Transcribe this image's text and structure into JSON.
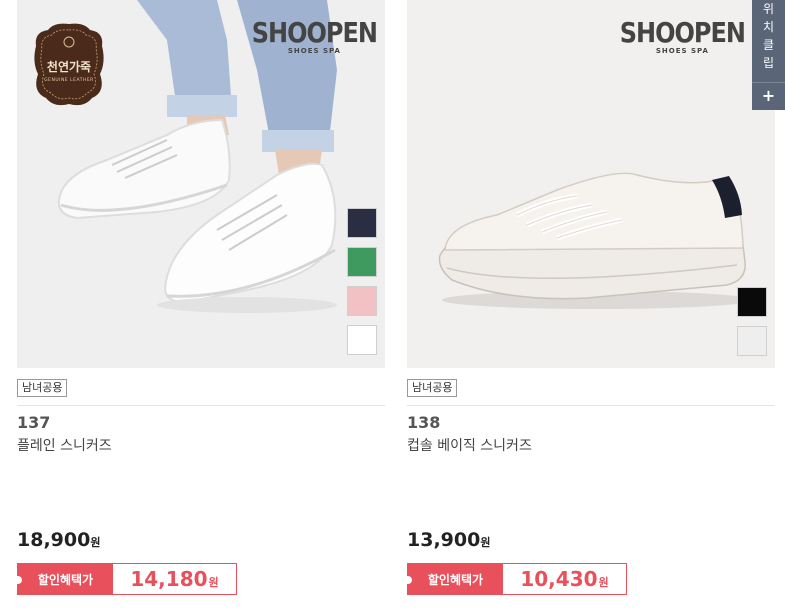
{
  "products": [
    {
      "brand": "SHOOPEN",
      "brand_sub": "SHOES SPA",
      "badge_text": "천연가죽",
      "badge_sub": "GENUINE LEATHER",
      "swatch_colors": [
        "#2b2d42",
        "#3e9a5e",
        "#f1c1c4",
        "#ffffff"
      ],
      "tag": "남녀공용",
      "number": "137",
      "name": "플레인 스니커즈",
      "price": "18,900",
      "won": "원",
      "discount_label": "할인혜택가",
      "discount_price": "14,180"
    },
    {
      "brand": "SHOOPEN",
      "brand_sub": "SHOES SPA",
      "swatch_colors": [
        "#0a0a0a",
        "#eeeeee"
      ],
      "tag": "남녀공용",
      "number": "138",
      "name": "컵솔 베이직 스니커즈",
      "price": "13,900",
      "won": "원",
      "discount_label": "할인혜택가",
      "discount_price": "10,430"
    }
  ],
  "side_widget": {
    "text_lines": [
      "위",
      "치",
      "클",
      "립"
    ],
    "plus": "+"
  },
  "colors": {
    "accent": "#e8505b",
    "widget_bg": "#5a6578"
  }
}
